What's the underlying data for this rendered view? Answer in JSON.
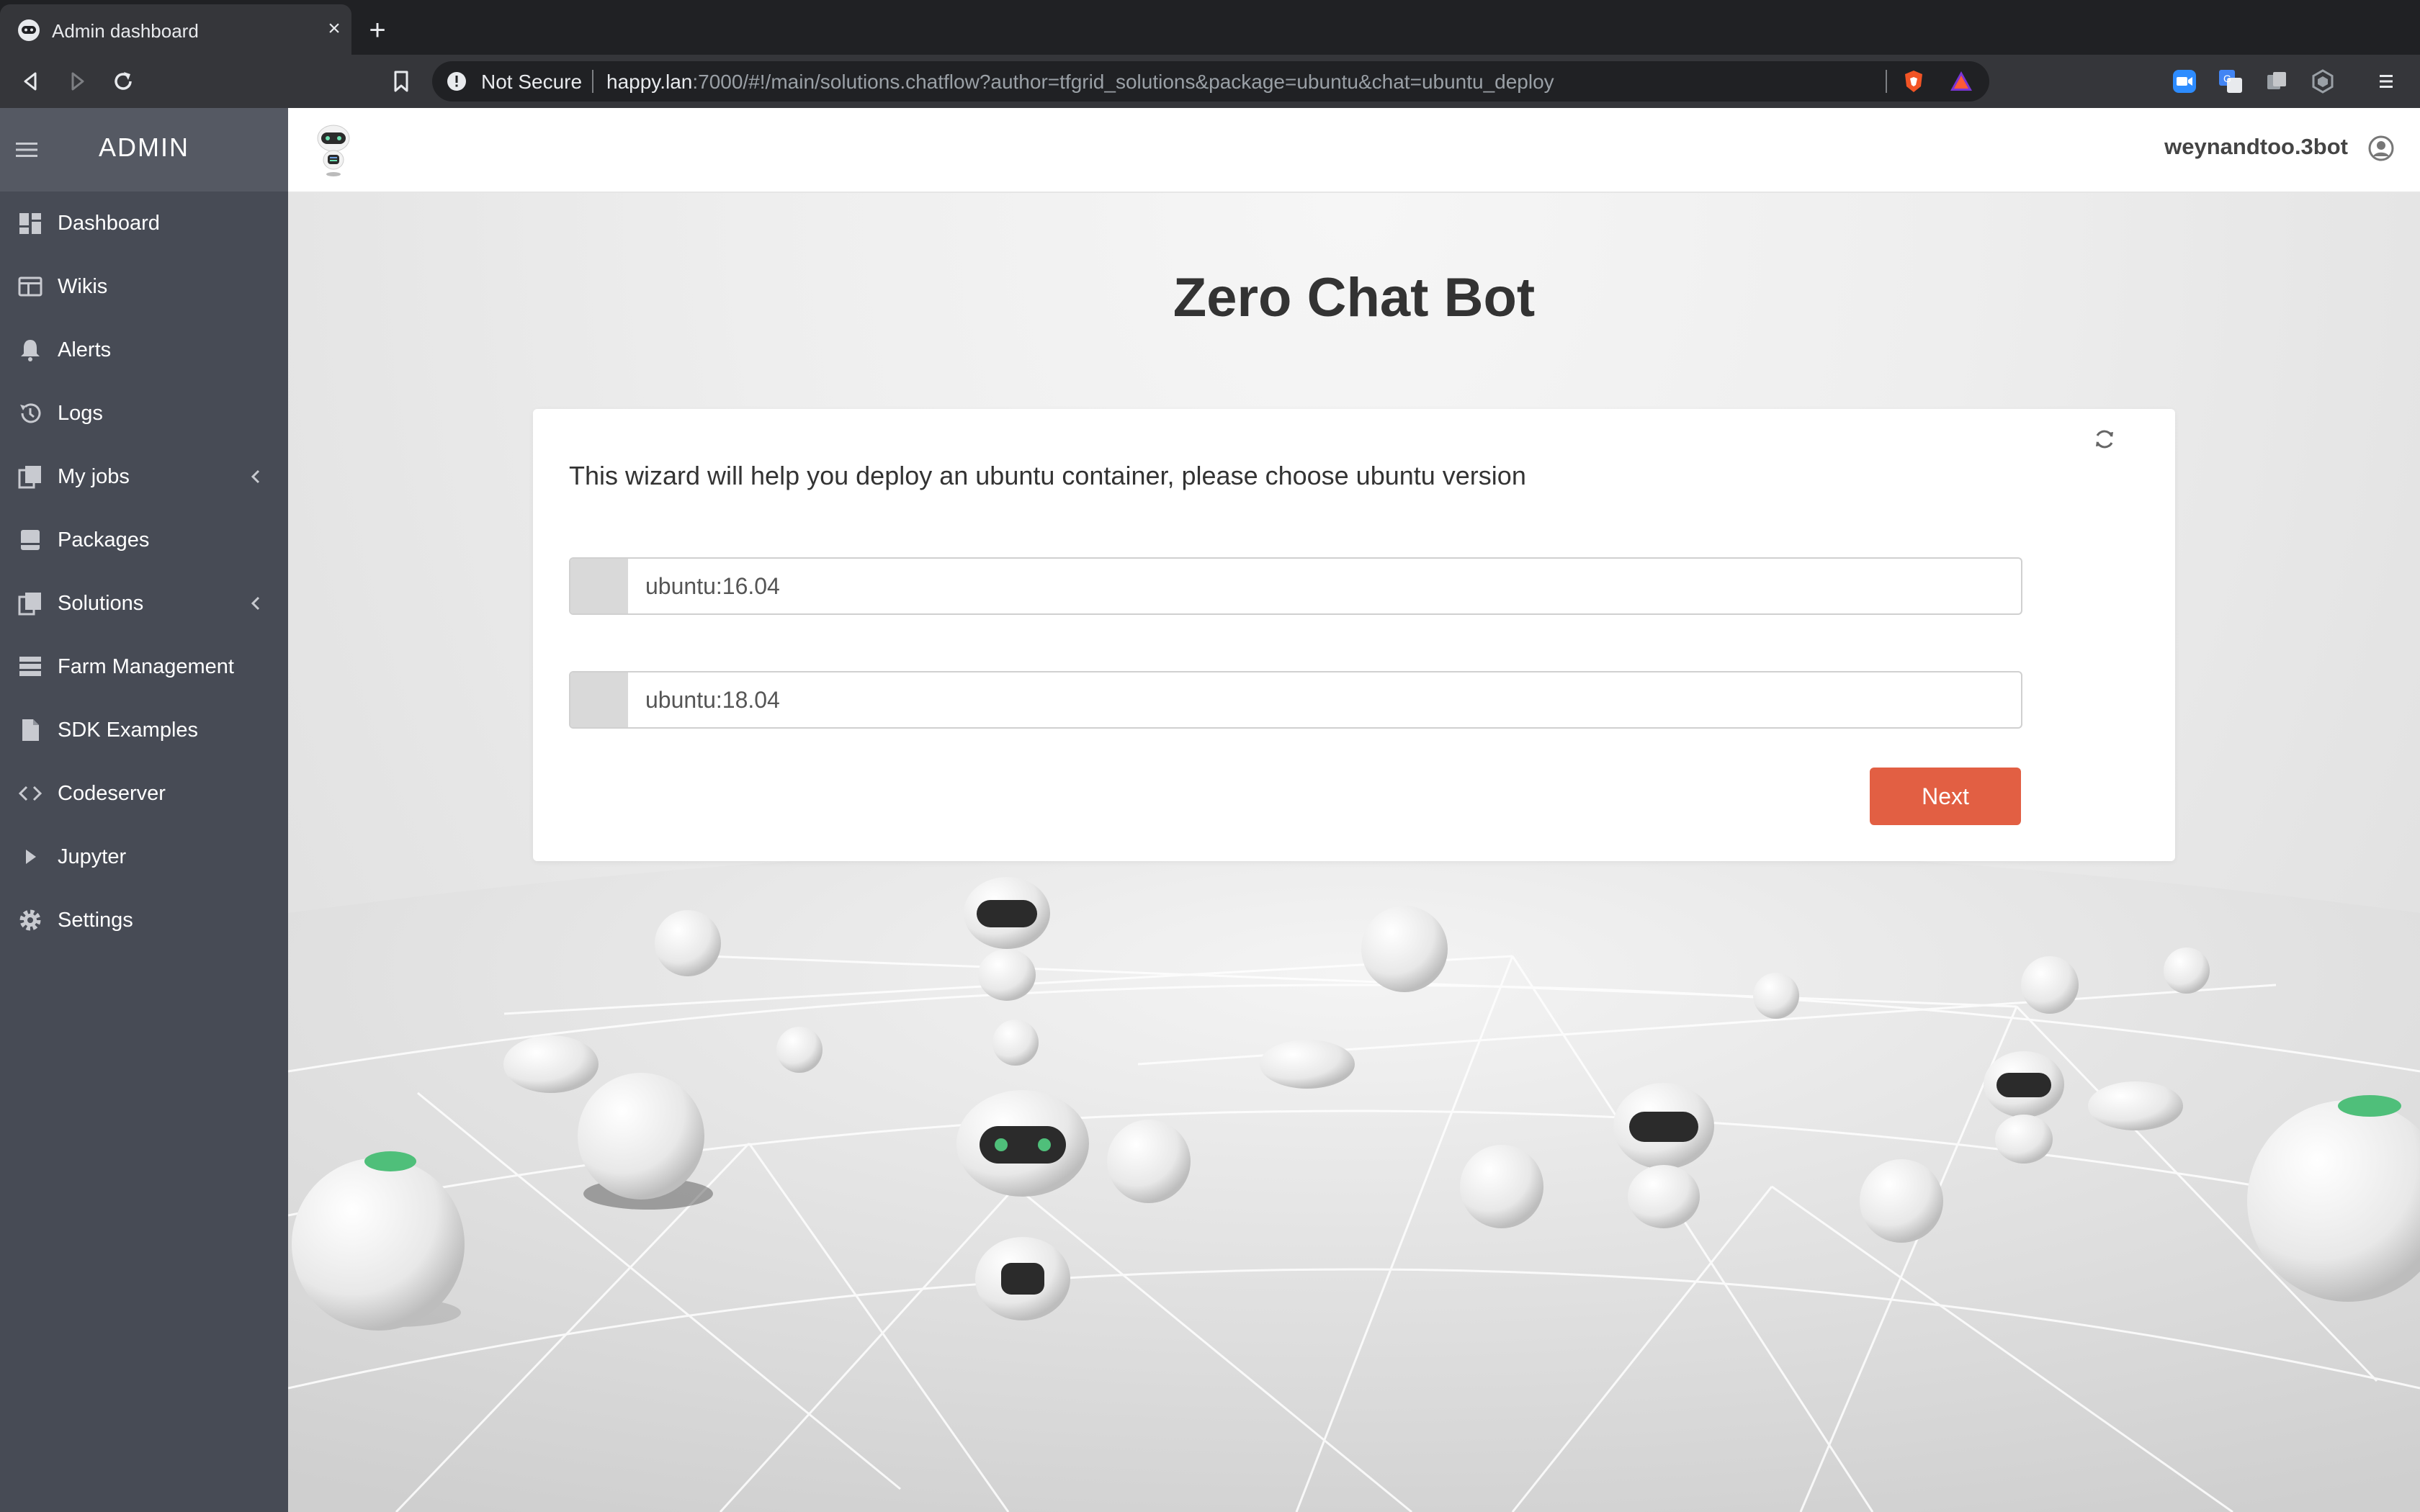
{
  "browser": {
    "tab_title": "Admin dashboard",
    "new_tab_symbol": "+",
    "close_symbol": "×",
    "security_label": "Not Secure",
    "url_host": "happy.lan",
    "url_rest": ":7000/#!/main/solutions.chatflow?author=tfgrid_solutions&package=ubuntu&chat=ubuntu_deploy"
  },
  "sidebar": {
    "title": "ADMIN",
    "items": [
      {
        "label": "Dashboard",
        "icon": "dashboard-icon"
      },
      {
        "label": "Wikis",
        "icon": "wikis-icon"
      },
      {
        "label": "Alerts",
        "icon": "bell-icon"
      },
      {
        "label": "Logs",
        "icon": "history-icon"
      },
      {
        "label": "My jobs",
        "icon": "jobs-icon",
        "expandable": true
      },
      {
        "label": "Packages",
        "icon": "package-icon"
      },
      {
        "label": "Solutions",
        "icon": "solutions-icon",
        "expandable": true
      },
      {
        "label": "Farm Management",
        "icon": "server-icon"
      },
      {
        "label": "SDK Examples",
        "icon": "file-icon"
      },
      {
        "label": "Codeserver",
        "icon": "code-icon"
      },
      {
        "label": "Jupyter",
        "icon": "play-icon"
      },
      {
        "label": "Settings",
        "icon": "gear-icon"
      }
    ]
  },
  "header": {
    "username": "weynandtoo.3bot"
  },
  "main": {
    "title": "Zero Chat Bot",
    "question": "This wizard will help you deploy an ubuntu container, please choose ubuntu version",
    "options": [
      {
        "label": "ubuntu:16.04",
        "selected": false
      },
      {
        "label": "ubuntu:18.04",
        "selected": false
      }
    ],
    "next_label": "Next"
  },
  "colors": {
    "sidebar": "#474b55",
    "accent_button": "#e25f43",
    "browser_chrome": "#35363a"
  }
}
